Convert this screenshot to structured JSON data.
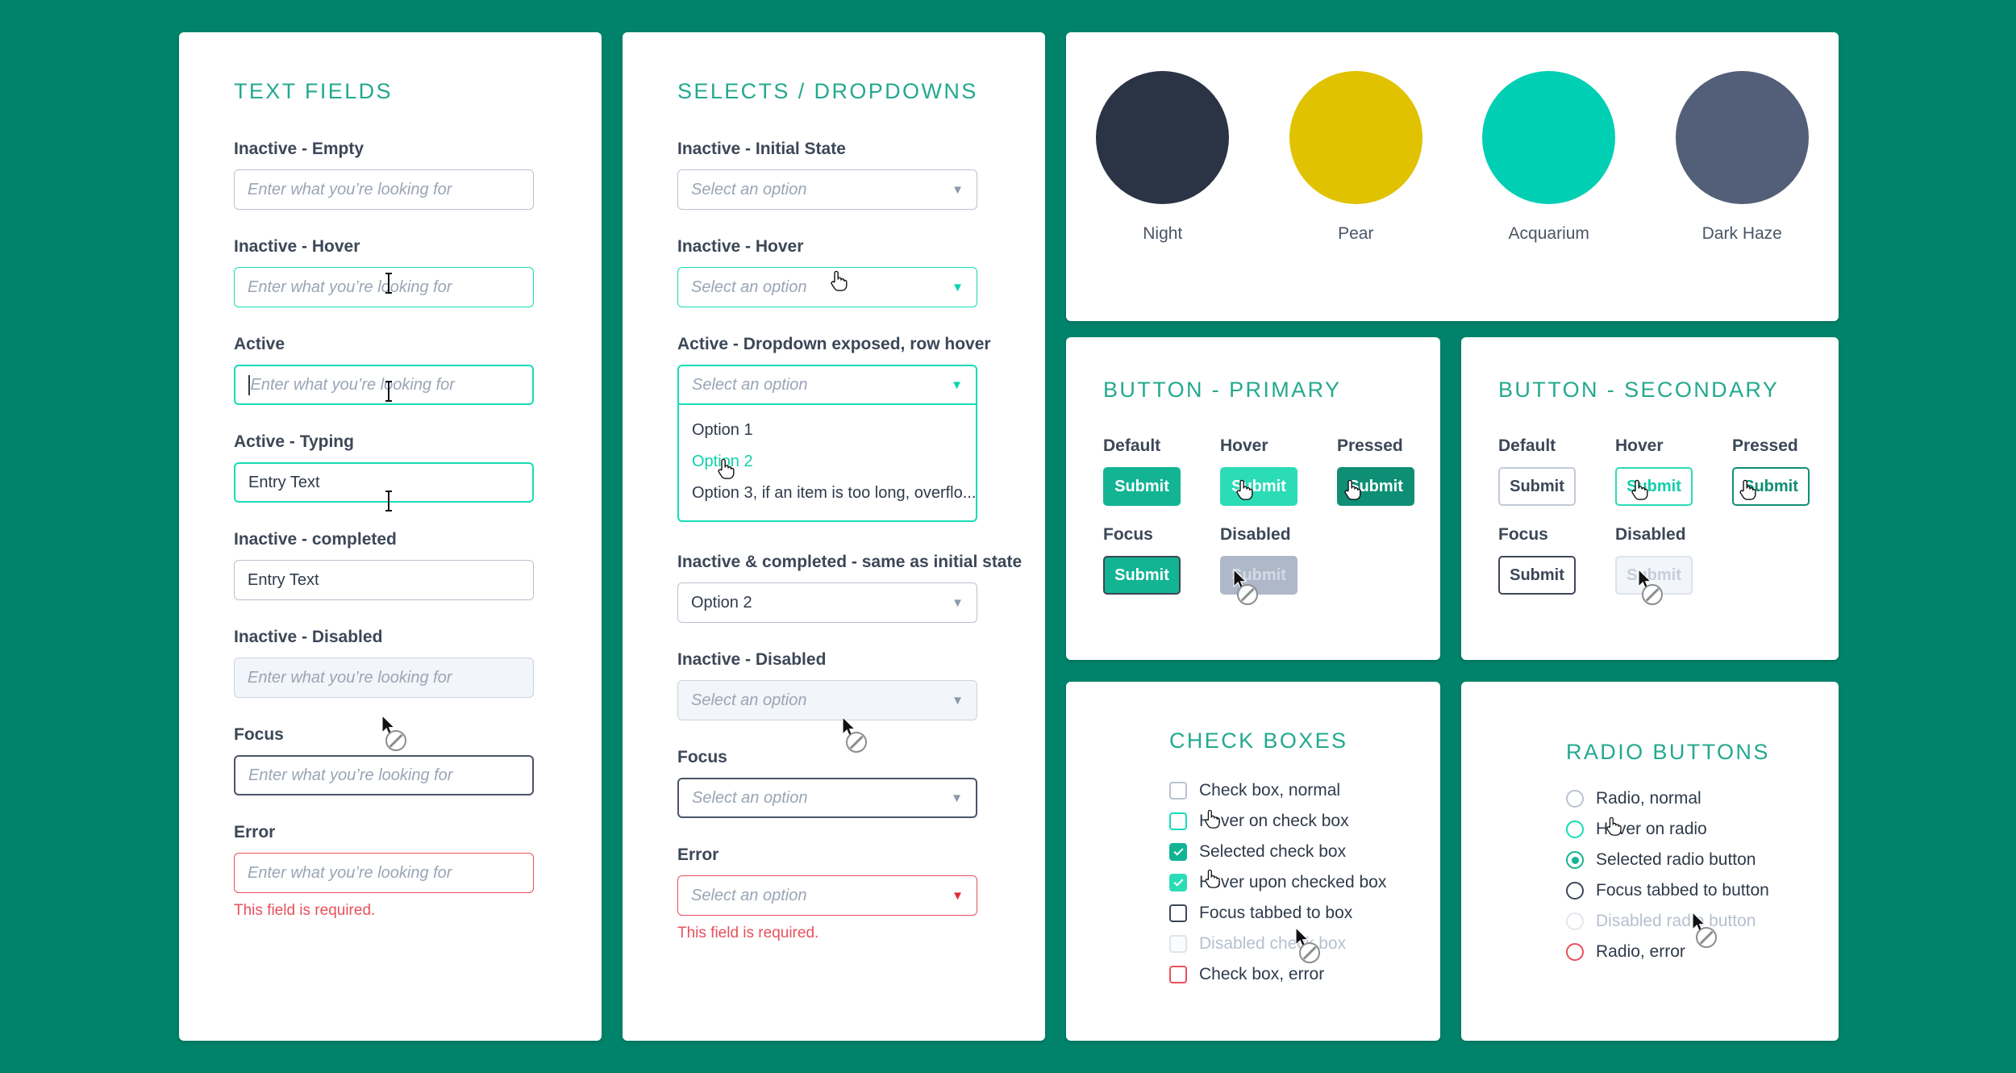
{
  "theme": {
    "background": "#00836A",
    "accent_teal": "#23A98E",
    "primary": "#12B494",
    "hover_teal": "#2CDCB6",
    "pressed_teal": "#0E8F75",
    "error_red": "#E8505B",
    "label_slate": "#3C4757"
  },
  "text_fields": {
    "title": "TEXT FIELDS",
    "placeholder": "Enter what you’re looking for",
    "fields": [
      {
        "label": "Inactive - Empty",
        "state": "default",
        "value": ""
      },
      {
        "label": "Inactive - Hover",
        "state": "hover",
        "value": ""
      },
      {
        "label": "Active",
        "state": "active",
        "value": ""
      },
      {
        "label": "Active - Typing",
        "state": "active",
        "value": "Entry Text"
      },
      {
        "label": "Inactive - completed",
        "state": "default",
        "value": "Entry Text"
      },
      {
        "label": "Inactive - Disabled",
        "state": "disabled",
        "value": ""
      },
      {
        "label": "Focus",
        "state": "focus",
        "value": ""
      },
      {
        "label": "Error",
        "state": "error",
        "value": ""
      }
    ],
    "error_message": "This field is required."
  },
  "selects": {
    "title": "SELECTS / DROPDOWNS",
    "placeholder": "Select an option",
    "fields": [
      {
        "label": "Inactive - Initial State",
        "state": "default",
        "value": ""
      },
      {
        "label": "Inactive - Hover",
        "state": "hover",
        "value": ""
      },
      {
        "label": "Active - Dropdown exposed, row hover",
        "state": "active",
        "value": ""
      },
      {
        "label": "Inactive & completed - same as initial state",
        "state": "default",
        "value": "Option 2"
      },
      {
        "label": "Inactive - Disabled",
        "state": "disabled",
        "value": ""
      },
      {
        "label": "Focus",
        "state": "focus",
        "value": ""
      },
      {
        "label": "Error",
        "state": "error",
        "value": ""
      }
    ],
    "menu_options": [
      {
        "label": "Option 1",
        "hovered": false
      },
      {
        "label": "Option 2",
        "hovered": true
      },
      {
        "label": "Option 3, if an item is too long, overflo...",
        "hovered": false
      }
    ],
    "error_message": "This field is required.",
    "arrow_glyph": "▼"
  },
  "colors_card": {
    "swatches": [
      {
        "name": "Night",
        "hex": "#2B3445"
      },
      {
        "name": "Pear",
        "hex": "#E0C200"
      },
      {
        "name": "Acquarium",
        "hex": "#00CFB4"
      },
      {
        "name": "Dark Haze",
        "hex": "#535F78"
      }
    ]
  },
  "button_primary": {
    "title": "BUTTON - PRIMARY",
    "states": [
      {
        "label": "Default",
        "text": "Submit",
        "variant": "p-default"
      },
      {
        "label": "Hover",
        "text": "Submit",
        "variant": "p-hover"
      },
      {
        "label": "Pressed",
        "text": "Submit",
        "variant": "p-pressed"
      },
      {
        "label": "Focus",
        "text": "Submit",
        "variant": "p-focus"
      },
      {
        "label": "Disabled",
        "text": "Submit",
        "variant": "p-disabled"
      }
    ]
  },
  "button_secondary": {
    "title": "BUTTON - SECONDARY",
    "states": [
      {
        "label": "Default",
        "text": "Submit",
        "variant": "s-default"
      },
      {
        "label": "Hover",
        "text": "Submit",
        "variant": "s-hover"
      },
      {
        "label": "Pressed",
        "text": "Submit",
        "variant": "s-pressed"
      },
      {
        "label": "Focus",
        "text": "Submit",
        "variant": "s-focus"
      },
      {
        "label": "Disabled",
        "text": "Submit",
        "variant": "s-disabled"
      }
    ]
  },
  "check_boxes": {
    "title": "CHECK BOXES",
    "items": [
      {
        "label": "Check box, normal",
        "state": "default"
      },
      {
        "label": "Hover on check box",
        "state": "hover"
      },
      {
        "label": "Selected check box",
        "state": "checked"
      },
      {
        "label": "Hover upon checked box",
        "state": "checked-hover"
      },
      {
        "label": "Focus tabbed to box",
        "state": "focus"
      },
      {
        "label": "Disabled check box",
        "state": "disabled"
      },
      {
        "label": "Check box, error",
        "state": "error"
      }
    ]
  },
  "radio_buttons": {
    "title": "RADIO BUTTONS",
    "items": [
      {
        "label": "Radio, normal",
        "state": "default"
      },
      {
        "label": "Hover on radio",
        "state": "hover"
      },
      {
        "label": "Selected radio button",
        "state": "selected"
      },
      {
        "label": "Focus tabbed to button",
        "state": "focus"
      },
      {
        "label": "Disabled radio button",
        "state": "disabled"
      },
      {
        "label": "Radio, error",
        "state": "error"
      }
    ]
  }
}
